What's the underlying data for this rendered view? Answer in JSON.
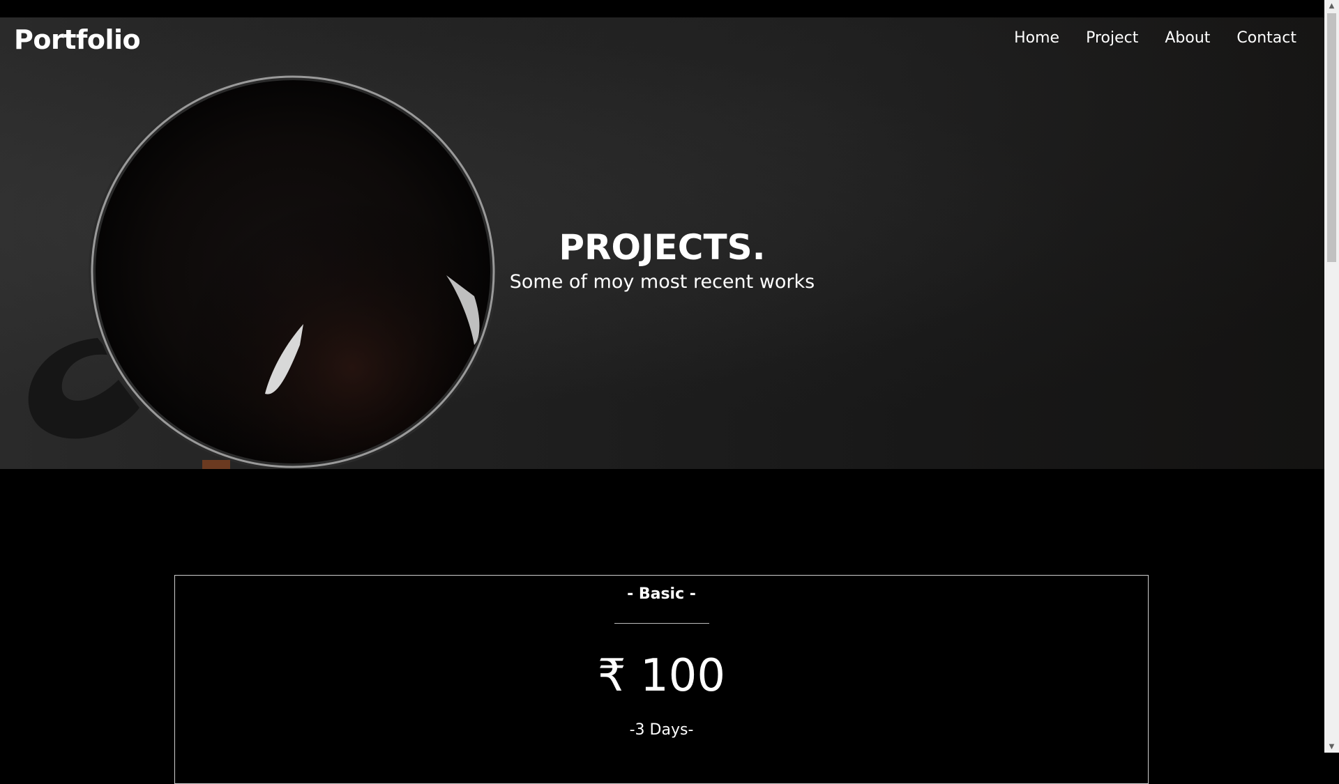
{
  "brand": {
    "name": "Portfolio"
  },
  "nav": {
    "items": [
      {
        "label": "Home"
      },
      {
        "label": "Project"
      },
      {
        "label": "About"
      },
      {
        "label": "Contact"
      }
    ]
  },
  "hero": {
    "title": "PROJECTS.",
    "subtitle": "Some of moy most recent works"
  },
  "pricing": {
    "plans": [
      {
        "name": "- Basic -",
        "price": "₹ 100",
        "duration": "-3 Days-"
      }
    ]
  },
  "scrollbar": {
    "up_arrow": "▲",
    "down_arrow": "▼"
  },
  "colors": {
    "background": "#000000",
    "text": "#ffffff",
    "card_border": "#cfcfcf"
  }
}
